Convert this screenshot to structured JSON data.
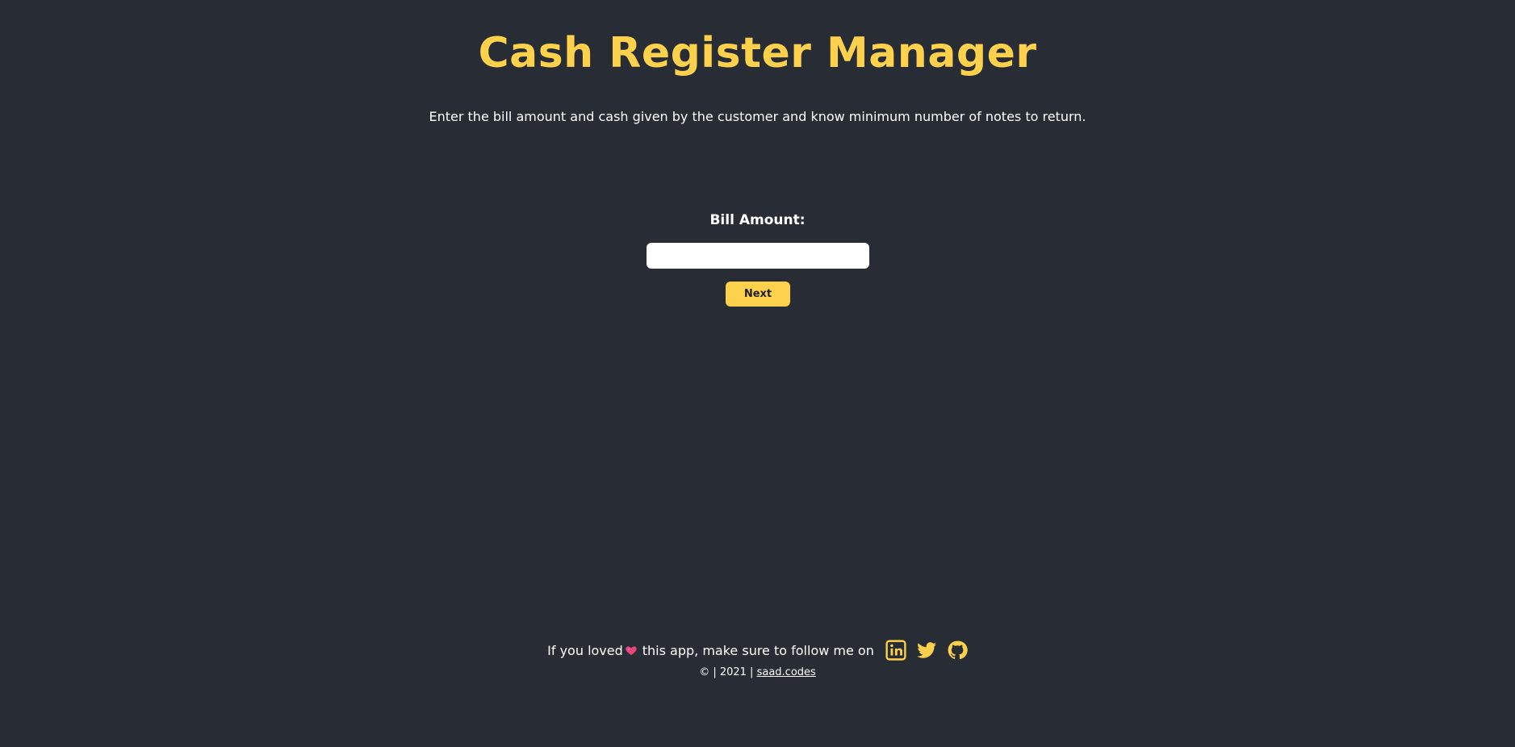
{
  "header": {
    "title": "Cash Register Manager",
    "subtitle": "Enter the bill amount and cash given by the customer and know minimum number of notes to return."
  },
  "form": {
    "bill_label": "Bill Amount:",
    "bill_value": "",
    "next_label": "Next"
  },
  "footer": {
    "text_before": "If you loved",
    "heart_icon": "heart-icon",
    "text_after": "this app, make sure to follow me on",
    "social_icons": [
      "linkedin-icon",
      "twitter-icon",
      "github-icon"
    ],
    "copyright_text": "© | 2021 |",
    "site_link": "saad.codes"
  },
  "colors": {
    "background": "#282c34",
    "accent": "#fdd14b",
    "heart": "#e8457a"
  }
}
